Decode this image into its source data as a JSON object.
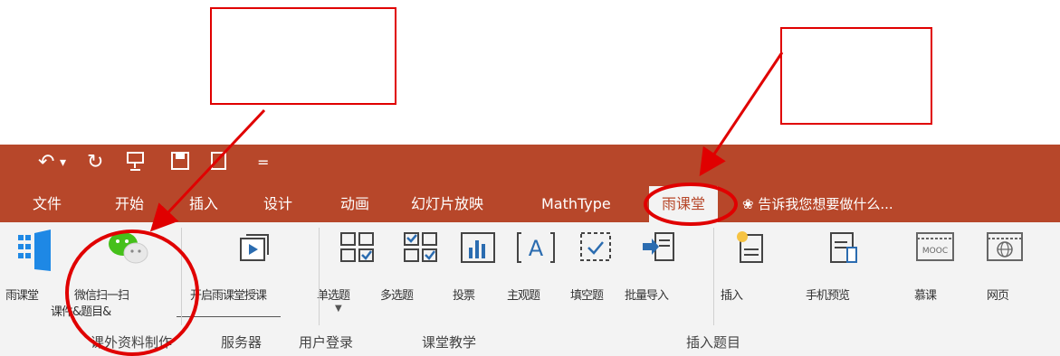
{
  "quick_access": {
    "undo_icon": "undo-icon",
    "redo_icon": "redo-icon",
    "present_icon": "present-icon",
    "save_icon": "save-icon",
    "new_icon": "new-slide-icon",
    "customize": "="
  },
  "tabs": [
    "文件",
    "开始",
    "插入",
    "设计",
    "动画",
    "幻灯片放映",
    "MathType",
    "雨课堂"
  ],
  "active_tab": "雨课堂",
  "tell_me": "告诉我您想要做什么...",
  "ribbon_labels": {
    "yuketang": "雨课堂",
    "wechat": "微信扫一扫",
    "open_ppt": "开启雨课堂授课",
    "single_choice": "单选题",
    "multi_choice": "多选题",
    "vote": "投票",
    "subjective": "主观题",
    "fill_blank": "填空题",
    "batch_import": "批量导入",
    "insert_blank": "插入",
    "phone_preview": "手机预览",
    "mooc": "慕课",
    "web": "网页",
    "sub_line": "课件&题目&"
  },
  "groups": {
    "materials": "课外资料制作",
    "server": "服务器",
    "login": "用户登录",
    "teaching": "课堂教学",
    "insert_q": "插入题目"
  },
  "colors": {
    "titlebar": "#b7472a",
    "annotation": "#e00000"
  },
  "mooc_icon_label": "MOOC"
}
